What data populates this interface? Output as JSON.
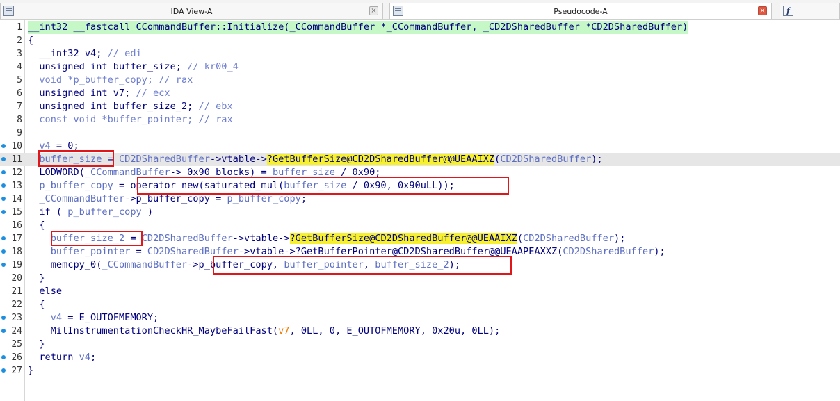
{
  "tabs": [
    {
      "title": "IDA View-A",
      "icon": "list-icon",
      "close": "×",
      "active": false
    },
    {
      "title": "Pseudocode-A",
      "icon": "list-icon",
      "close": "×",
      "active": true
    },
    {
      "title": "",
      "icon": "function-icon",
      "glyph": "f",
      "active": false
    }
  ],
  "colors": {
    "keyword": "#000080",
    "variable": "#5d6fc4",
    "highlight": "#f7f02c",
    "annotation_box": "#e0161b",
    "breakpoint_dot": "#1e8fe0"
  },
  "lines": [
    {
      "n": "1",
      "dot": false,
      "hl": false,
      "segs": [
        [
          "k",
          "__int32 __fastcall CCommandBuffer::Initialize(_CCommandBuffer *_CCommandBuffer, _CD2DSharedBuffer *CD2DSharedBuffer)"
        ]
      ]
    },
    {
      "n": "2",
      "dot": false,
      "hl": false,
      "segs": [
        [
          "k",
          "{"
        ]
      ]
    },
    {
      "n": "3",
      "dot": false,
      "hl": false,
      "segs": [
        [
          "k",
          "  __int32 v4; "
        ],
        [
          "cm",
          "// edi"
        ]
      ]
    },
    {
      "n": "4",
      "dot": false,
      "hl": false,
      "segs": [
        [
          "k",
          "  unsigned int buffer_size; "
        ],
        [
          "cm",
          "// kr00_4"
        ]
      ]
    },
    {
      "n": "5",
      "dot": false,
      "hl": false,
      "segs": [
        [
          "cm",
          "  void *p_buffer_copy; // rax"
        ]
      ]
    },
    {
      "n": "6",
      "dot": false,
      "hl": false,
      "segs": [
        [
          "k",
          "  unsigned int v7; "
        ],
        [
          "cm",
          "// ecx"
        ]
      ]
    },
    {
      "n": "7",
      "dot": false,
      "hl": false,
      "segs": [
        [
          "k",
          "  unsigned int buffer_size_2; "
        ],
        [
          "cm",
          "// ebx"
        ]
      ]
    },
    {
      "n": "8",
      "dot": false,
      "hl": false,
      "segs": [
        [
          "cm",
          "  const void *buffer_pointer; // rax"
        ]
      ]
    },
    {
      "n": "9",
      "dot": false,
      "hl": false,
      "segs": [
        [
          "k",
          ""
        ]
      ]
    },
    {
      "n": "10",
      "dot": true,
      "hl": false,
      "segs": [
        [
          "v",
          "  v4"
        ],
        [
          "k",
          " = 0;"
        ]
      ]
    },
    {
      "n": "11",
      "dot": true,
      "hl": true,
      "segs": [
        [
          "v",
          "  buffer_size"
        ],
        [
          "k",
          " = "
        ],
        [
          "v",
          "CD2DSharedBuffer"
        ],
        [
          "k",
          "->vtable->"
        ],
        [
          "h",
          "?GetBufferSize@CD2DSharedBuffer@@UEAAIXZ"
        ],
        [
          "k",
          "("
        ],
        [
          "v",
          "CD2DSharedBuffer"
        ],
        [
          "k",
          ");"
        ]
      ]
    },
    {
      "n": "12",
      "dot": true,
      "hl": false,
      "segs": [
        [
          "k",
          "  LODWORD("
        ],
        [
          "v",
          "_CCommandBuffer"
        ],
        [
          "k",
          "-> 0x90 blocks) = "
        ],
        [
          "v",
          "buffer_size"
        ],
        [
          "k",
          " / 0x90;"
        ]
      ]
    },
    {
      "n": "13",
      "dot": true,
      "hl": false,
      "segs": [
        [
          "v",
          "  p_buffer_copy"
        ],
        [
          "k",
          " = operator new(saturated_mul("
        ],
        [
          "v",
          "buffer_size"
        ],
        [
          "k",
          " / 0x90, 0x90uLL));"
        ]
      ]
    },
    {
      "n": "14",
      "dot": true,
      "hl": false,
      "segs": [
        [
          "v",
          "  _CCommandBuffer"
        ],
        [
          "k",
          "->p_buffer_copy = "
        ],
        [
          "v",
          "p_buffer_copy"
        ],
        [
          "k",
          ";"
        ]
      ]
    },
    {
      "n": "15",
      "dot": true,
      "hl": false,
      "segs": [
        [
          "k",
          "  if ( "
        ],
        [
          "v",
          "p_buffer_copy"
        ],
        [
          "k",
          " )"
        ]
      ]
    },
    {
      "n": "16",
      "dot": false,
      "hl": false,
      "segs": [
        [
          "k",
          "  {"
        ]
      ]
    },
    {
      "n": "17",
      "dot": true,
      "hl": false,
      "segs": [
        [
          "v",
          "    buffer_size_2"
        ],
        [
          "k",
          " = "
        ],
        [
          "v",
          "CD2DSharedBuffer"
        ],
        [
          "k",
          "->vtable->"
        ],
        [
          "h",
          "?GetBufferSize@CD2DSharedBuffer@@UEAAIXZ"
        ],
        [
          "k",
          "("
        ],
        [
          "v",
          "CD2DSharedBuffer"
        ],
        [
          "k",
          ");"
        ]
      ]
    },
    {
      "n": "18",
      "dot": true,
      "hl": false,
      "segs": [
        [
          "v",
          "    buffer_pointer"
        ],
        [
          "k",
          " = "
        ],
        [
          "v",
          "CD2DSharedBuffer"
        ],
        [
          "k",
          "->vtable->?GetBufferPointer@CD2DSharedBuffer@@UEAAPEAXXZ("
        ],
        [
          "v",
          "CD2DSharedBuffer"
        ],
        [
          "k",
          ");"
        ]
      ]
    },
    {
      "n": "19",
      "dot": true,
      "hl": false,
      "segs": [
        [
          "k",
          "    memcpy_0("
        ],
        [
          "v",
          "_CCommandBuffer"
        ],
        [
          "k",
          "->p_buffer_copy, "
        ],
        [
          "v",
          "buffer_pointer"
        ],
        [
          "k",
          ", "
        ],
        [
          "v",
          "buffer_size_2"
        ],
        [
          "k",
          ");"
        ]
      ]
    },
    {
      "n": "20",
      "dot": false,
      "hl": false,
      "segs": [
        [
          "k",
          "  }"
        ]
      ]
    },
    {
      "n": "21",
      "dot": false,
      "hl": false,
      "segs": [
        [
          "k",
          "  else"
        ]
      ]
    },
    {
      "n": "22",
      "dot": false,
      "hl": false,
      "segs": [
        [
          "k",
          "  {"
        ]
      ]
    },
    {
      "n": "23",
      "dot": true,
      "hl": false,
      "segs": [
        [
          "v",
          "    v4"
        ],
        [
          "k",
          " = E_OUTOFMEMORY;"
        ]
      ]
    },
    {
      "n": "24",
      "dot": true,
      "hl": false,
      "segs": [
        [
          "k",
          "    MilInstrumentationCheckHR_MaybeFailFast("
        ],
        [
          "o",
          "v7"
        ],
        [
          "k",
          ", 0LL, 0, E_OUTOFMEMORY, 0x20u, 0LL);"
        ]
      ]
    },
    {
      "n": "25",
      "dot": false,
      "hl": false,
      "segs": [
        [
          "k",
          "  }"
        ]
      ]
    },
    {
      "n": "26",
      "dot": true,
      "hl": false,
      "segs": [
        [
          "k",
          "  return "
        ],
        [
          "v",
          "v4"
        ],
        [
          "k",
          ";"
        ]
      ]
    },
    {
      "n": "27",
      "dot": true,
      "hl": false,
      "segs": [
        [
          "k",
          "}"
        ]
      ]
    }
  ]
}
